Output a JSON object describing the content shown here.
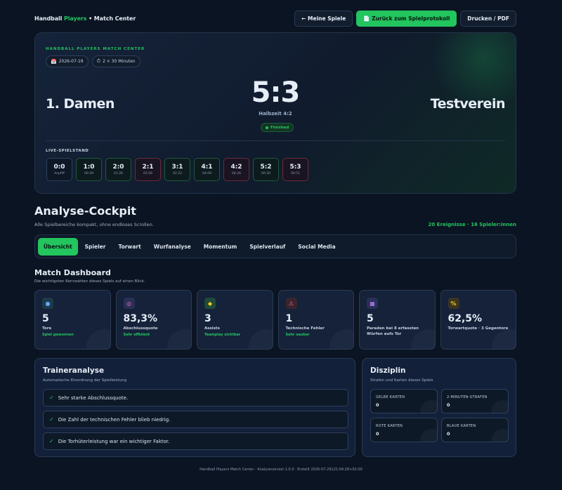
{
  "header": {
    "brand_part1": "Handball ",
    "brand_part2": "Players",
    "brand_part3": " • Match Center",
    "nav": {
      "back_label": "← Meine Spiele",
      "protocol_label": "📄 Zurück zum Spielprotokoll",
      "print_label": "Drucken / PDF"
    }
  },
  "hero": {
    "eyebrow": "HANDBALL PLAYERS MATCH CENTER",
    "date": "2026-07-19",
    "duration": "2 × 30 Minuten",
    "home_team": "1. Damen",
    "away_team": "Testverein",
    "score": "5:3",
    "halftime": "Halbzeit 4:2",
    "status": "Finished",
    "live_label": "LIVE-SPIELSTAND",
    "timeline": [
      {
        "score": "0:0",
        "time": "Anpfiff",
        "kind": "neutral"
      },
      {
        "score": "1:0",
        "time": "00:39",
        "kind": "home"
      },
      {
        "score": "2:0",
        "time": "01:26",
        "kind": "home"
      },
      {
        "score": "2:1",
        "time": "01:56",
        "kind": "away"
      },
      {
        "score": "3:1",
        "time": "02:22",
        "kind": "home"
      },
      {
        "score": "4:1",
        "time": "04:09",
        "kind": "home"
      },
      {
        "score": "4:2",
        "time": "04:26",
        "kind": "away"
      },
      {
        "score": "5:2",
        "time": "00:30",
        "kind": "home"
      },
      {
        "score": "5:3",
        "time": "00:51",
        "kind": "away"
      }
    ]
  },
  "cockpit": {
    "title": "Analyse-Cockpit",
    "subtitle": "Alle Spielbereiche kompakt, ohne endloses Scrollen.",
    "events": "20 Ereignisse · 16 Spieler:innen",
    "tabs": [
      "Übersicht",
      "Spieler",
      "Torwart",
      "Wurfanalyse",
      "Momentum",
      "Spielverlauf",
      "Social Media"
    ],
    "active_tab": 0
  },
  "dashboard": {
    "title": "Match Dashboard",
    "subtitle": "Die wichtigsten Kennzahlen dieses Spiels auf einen Blick.",
    "kpis": [
      {
        "icon": "handball-icon",
        "glyph": "●",
        "icon_color": "#60a5fa",
        "icon_bg": "#1e3a4a",
        "value": "5",
        "label": "Tore",
        "note": "Spiel gewonnen"
      },
      {
        "icon": "target-icon",
        "glyph": "◎",
        "icon_color": "#f472b6",
        "icon_bg": "#2a2f55",
        "value": "83,3%",
        "label": "Abschlussquote",
        "note": "Sehr effizient"
      },
      {
        "icon": "handshake-icon",
        "glyph": "◆",
        "icon_color": "#facc15",
        "icon_bg": "#1f4a3a",
        "value": "3",
        "label": "Assists",
        "note": "Teamplay sichtbar"
      },
      {
        "icon": "warning-icon",
        "glyph": "⚠",
        "icon_color": "#f87171",
        "icon_bg": "#3a2430",
        "value": "1",
        "label": "Technische Fehler",
        "note": "Sehr sauber"
      },
      {
        "icon": "goal-net-icon",
        "glyph": "▦",
        "icon_color": "#c084fc",
        "icon_bg": "#2a2f55",
        "value": "5",
        "label": "Paraden bei 8 erfassten Würfen aufs Tor",
        "note": ""
      },
      {
        "icon": "percent-icon",
        "glyph": "%",
        "icon_color": "#facc15",
        "icon_bg": "#3a3420",
        "value": "62,5%",
        "label": "Torwartquote · 3 Gegentore",
        "note": ""
      }
    ]
  },
  "trainer": {
    "title": "Traineranalyse",
    "subtitle": "Automatische Einordnung der Spielleistung",
    "insights": [
      "Sehr starke Abschlussquote.",
      "Die Zahl der technischen Fehler blieb niedrig.",
      "Die Torhüterleistung war ein wichtiger Faktor."
    ]
  },
  "discipline": {
    "title": "Disziplin",
    "subtitle": "Strafen und Karten dieses Spiels",
    "cards": [
      {
        "label": "GELBE KARTEN",
        "value": "0"
      },
      {
        "label": "2-MINUTEN-STRAFEN",
        "value": "0"
      },
      {
        "label": "ROTE KARTEN",
        "value": "0"
      },
      {
        "label": "BLAUE KARTEN",
        "value": "0"
      }
    ]
  },
  "footer": "Handball Players Match Center · Analyseversion 1.0.0 · Erstellt 2026-07-29121:04:28+02:00"
}
